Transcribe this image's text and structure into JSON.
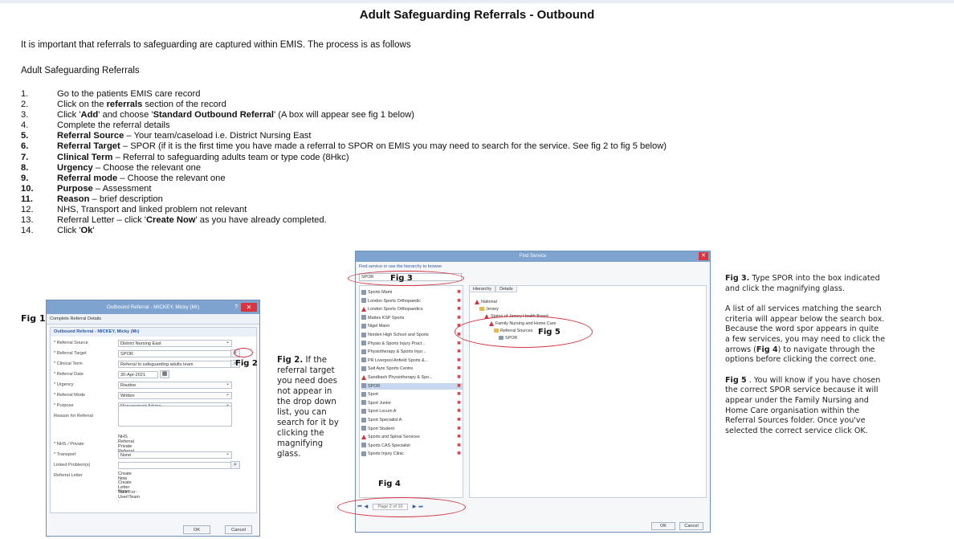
{
  "title": "Adult Safeguarding Referrals - Outbound",
  "intro": "It is important that referrals to safeguarding are captured within EMIS.  The process is as follows",
  "subheading": "Adult Safeguarding Referrals",
  "steps": [
    {
      "num": "1.",
      "pre": "Go to the patients EMIS care record",
      "bold": "",
      "post": ""
    },
    {
      "num": "2.",
      "pre": "Click on the ",
      "bold": "referrals",
      "post": " section of the record"
    },
    {
      "num": "3.",
      "pre": "Click '",
      "bold": "Add",
      "post": "' and choose '",
      "bold2": "Standard Outbound Referral",
      "post2": "' (A box will appear see fig 1 below)"
    },
    {
      "num": "4.",
      "pre": "Complete the referral details",
      "bold": "",
      "post": ""
    },
    {
      "num": "5.",
      "pre": "",
      "bold": "Referral Source",
      "post": " – Your team/caseload i.e. District Nursing East"
    },
    {
      "num": "6.",
      "pre": "",
      "bold": "Referral Target",
      "post": " – SPOR (if it is the first time you have made a referral to SPOR on EMIS you may need to search for the service. See fig 2 to fig 5 below)"
    },
    {
      "num": "7.",
      "pre": "",
      "bold": "Clinical Term",
      "post": " – Referral to safeguarding adults team or type code (8Hkc)"
    },
    {
      "num": "8.",
      "pre": "",
      "bold": "Urgency",
      "post": " – Choose the relevant one"
    },
    {
      "num": "9.",
      "pre": "",
      "bold": "Referral mode",
      "post": " – Choose the relevant one"
    },
    {
      "num": "10.",
      "pre": "",
      "bold": "Purpose",
      "post": " – Assessment"
    },
    {
      "num": "11.",
      "pre": "",
      "bold": "Reason",
      "post": " – brief description"
    },
    {
      "num": "12.",
      "pre": "NHS, Transport and linked problem not relevant",
      "bold": "",
      "post": ""
    },
    {
      "num": "13.",
      "pre": "Referral Letter – click '",
      "bold": "Create Now",
      "post": "' as you have already completed."
    },
    {
      "num": "14.",
      "pre": "Click '",
      "bold": "Ok",
      "post": "'"
    }
  ],
  "fig1": {
    "label": "Fig 1.",
    "window_title": "Outbound Referral - MICKEY, Micky (Mr)",
    "crumb": "Complete Referral Details",
    "panel_title": "Outbound Referral - MICKEY, Micky (Mr)",
    "fields": [
      {
        "label": "* Referral Source",
        "value": "District Nursing East"
      },
      {
        "label": "* Referral Target",
        "value": "SPOR"
      },
      {
        "label": "* Clinical Term",
        "value": "Referral to safeguarding adults team"
      },
      {
        "label": "* Referral Date",
        "value": "30-Apr-2021"
      },
      {
        "label": "* Urgency",
        "value": "Routine"
      },
      {
        "label": "* Referral Mode",
        "value": "Written"
      },
      {
        "label": "* Purpose",
        "value": "Management Advice"
      },
      {
        "label": "Reason for Referral",
        "value": ""
      },
      {
        "label": "* NHS / Private",
        "value": "NHS Referral    Private Referral"
      },
      {
        "label": "* Transport",
        "value": "None"
      },
      {
        "label": "Linked Problem(s)",
        "value": ""
      },
      {
        "label": "Referral Letter",
        "value": ""
      }
    ],
    "letter_options": [
      "Create Now",
      "Create Letter Task For :  User\\Team :",
      "None"
    ],
    "ok": "OK",
    "cancel": "Cancel",
    "fig2_tag": "Fig 2"
  },
  "fig2_text_pre": "",
  "fig2_bold": "Fig 2.",
  "fig2_text": " If the referral target you need does not appear in the drop down list, you can search for it by clicking the magnifying glass.",
  "fig_dialog": {
    "window_title": "Find Service",
    "hint": "Find service or use the hierarchy to browse",
    "search_value": "SPOR",
    "fig3_tag": "Fig 3",
    "results": [
      {
        "icon": "svc",
        "text": "Sports Mami"
      },
      {
        "icon": "svc",
        "text": "London Sports Orthopaedic"
      },
      {
        "icon": "warn",
        "text": "London Sports Orthopaedics"
      },
      {
        "icon": "svc",
        "text": "Mattes KSP Sports"
      },
      {
        "icon": "svc",
        "text": "Nigel Mann"
      },
      {
        "icon": "svc",
        "text": "Norden High School and Sports"
      },
      {
        "icon": "svc",
        "text": "Physio & Sports Injury Pract..."
      },
      {
        "icon": "svc",
        "text": "Physiotherapy & Sports Injur..."
      },
      {
        "icon": "svc",
        "text": "PR Liverpool Anfield Sports &..."
      },
      {
        "icon": "svc",
        "text": "Salt Ayre Sports Centre"
      },
      {
        "icon": "warn",
        "text": "Sandbach Physiotherapy & Spo..."
      },
      {
        "icon": "svc",
        "text": "SPOR"
      },
      {
        "icon": "svc",
        "text": "Sport"
      },
      {
        "icon": "svc",
        "text": "Sport Junior"
      },
      {
        "icon": "svc",
        "text": "Sport Locum A"
      },
      {
        "icon": "svc",
        "text": "Sport Specialist A"
      },
      {
        "icon": "svc",
        "text": "Sport Student"
      },
      {
        "icon": "warn",
        "text": "Sports and Spinal Services"
      },
      {
        "icon": "svc",
        "text": "Sports CAS Specialist"
      },
      {
        "icon": "svc",
        "text": "Sports Injury Clinic"
      }
    ],
    "tabs": [
      "Hierarchy",
      "Details"
    ],
    "tree": [
      {
        "icon": "warn",
        "text": "National",
        "indent": 0
      },
      {
        "icon": "folder",
        "text": "Jersey",
        "indent": 1
      },
      {
        "icon": "warn",
        "text": "States of Jersey Health Board",
        "indent": 2
      },
      {
        "icon": "warn",
        "text": "Family Nursing and Home Care",
        "indent": 3
      },
      {
        "icon": "folder",
        "text": "Referral Sources",
        "indent": 4
      },
      {
        "icon": "svc",
        "text": "SPOR",
        "indent": 5
      }
    ],
    "fig5_tag": "Fig 5",
    "fig4_tag": "Fig 4",
    "pager_text": "Page 2 of 10",
    "ok": "OK",
    "cancel": "Cancel"
  },
  "right": {
    "p1_bold": "Fig 3.",
    "p1": " Type SPOR into the box indicated and click the magnifying glass.",
    "p2_pre": "A list of all services matching the search criteria will appear below the search box. Because the word spor appears in quite a few services, you may need to click the arrows (",
    "p2_bold": "Fig 4",
    "p2_post": ") to navigate through the options before clicking the correct one.",
    "p3_bold": "Fig 5",
    "p3": " . You will know if you have chosen the correct SPOR service because it will appear under the Family Nursing and Home Care organisation within the Referral Sources folder. Once you've selected the correct service click OK."
  }
}
